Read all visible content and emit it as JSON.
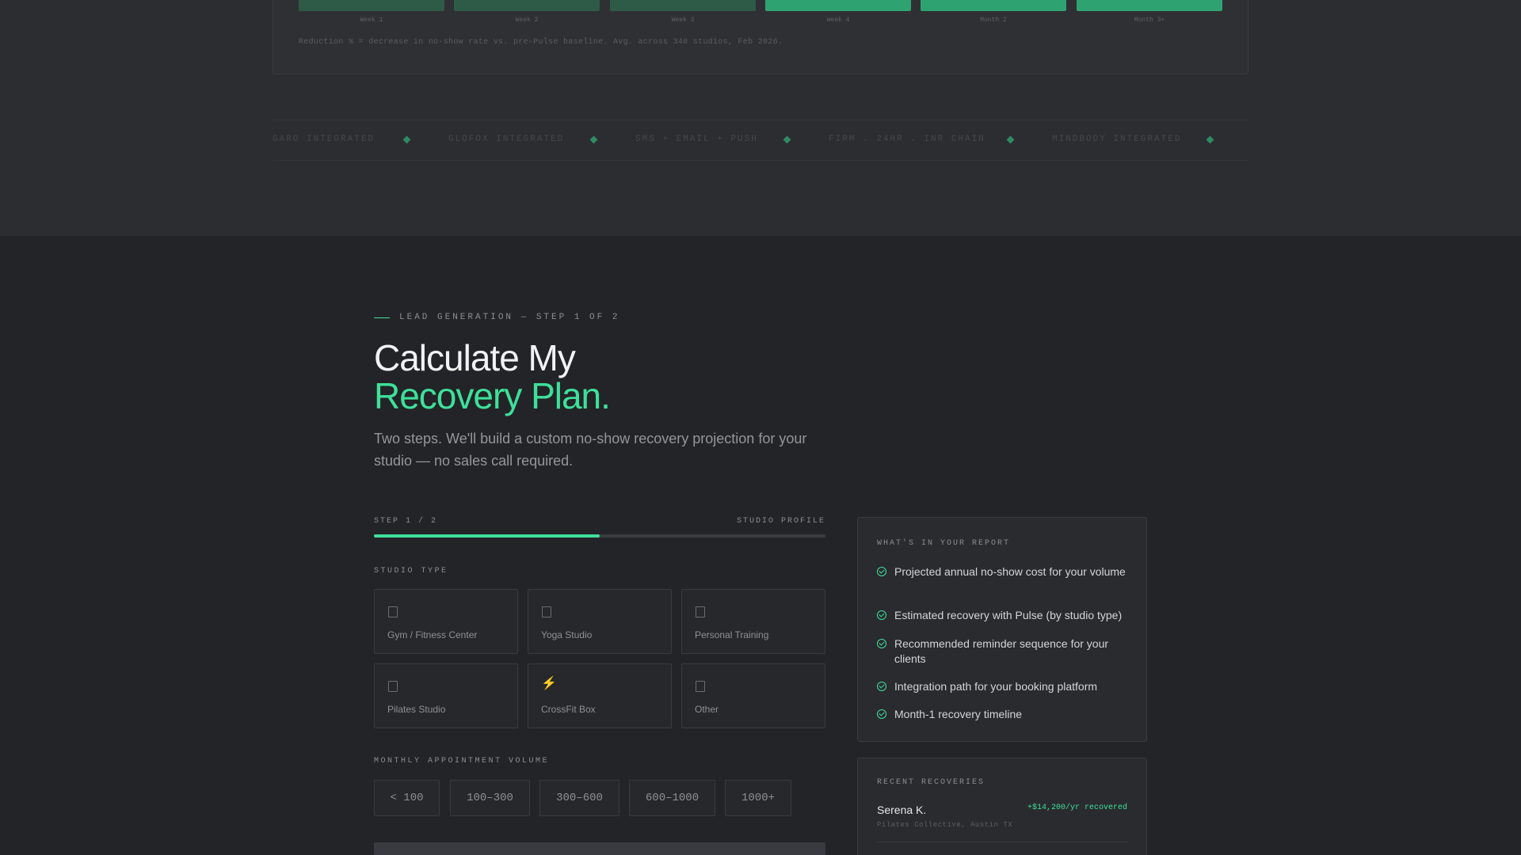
{
  "chart": {
    "bars": [
      {
        "label": "Week 1",
        "color": "#2e5a48"
      },
      {
        "label": "Week 2",
        "color": "#2e5a48"
      },
      {
        "label": "Week 3",
        "color": "#2e5a48"
      },
      {
        "label": "Week 4",
        "color": "#2fa271"
      },
      {
        "label": "Month 2",
        "color": "#2fa271"
      },
      {
        "label": "Month 3+",
        "color": "#2fa271"
      }
    ],
    "note": "Reduction % = decrease in no-show rate vs. pre-Pulse baseline. Avg. across 340 studios, Feb 2026."
  },
  "ticker": {
    "items": [
      "GARO INTEGRATED",
      "GLOFOX INTEGRATED",
      "SMS + EMAIL + PUSH",
      "FIRM . 24HR . INR CHAIN",
      "MINDBODY INTEGRATED"
    ]
  },
  "hero": {
    "eyebrow": "LEAD GENERATION — STEP 1 OF 2",
    "title_line1": "Calculate My",
    "title_line2": "Recovery Plan.",
    "subtitle": "Two steps. We'll build a custom no-show recovery projection for your studio — no sales call required."
  },
  "form": {
    "step_label": "STEP 1 / 2",
    "step_name": "STUDIO PROFILE",
    "progress": 0.5,
    "studio_type_label": "STUDIO TYPE",
    "studio_types": [
      {
        "label": "Gym / Fitness Center",
        "icon": "gym-icon"
      },
      {
        "label": "Yoga Studio",
        "icon": "yoga-icon"
      },
      {
        "label": "Personal Training",
        "icon": "training-icon"
      },
      {
        "label": "Pilates Studio",
        "icon": "pilates-icon"
      },
      {
        "label": "CrossFit Box",
        "icon": "lightning-icon"
      },
      {
        "label": "Other",
        "icon": "other-icon"
      }
    ],
    "volume_label": "MONTHLY APPOINTMENT VOLUME",
    "volumes": [
      "< 100",
      "100–300",
      "300–600",
      "600–1000",
      "1000+"
    ]
  },
  "report": {
    "title": "WHAT'S IN YOUR REPORT",
    "items": [
      "Projected annual no-show cost for your volume",
      "Estimated recovery with Pulse (by studio type)",
      "Recommended reminder sequence for your clients",
      "Integration path for your booking platform",
      "Month-1 recovery timeline"
    ]
  },
  "recoveries": {
    "title": "RECENT RECOVERIES",
    "entries": [
      {
        "name": "Serena K.",
        "amount": "+$14,200/yr recovered",
        "meta": "Pilates Collective, Austin TX"
      }
    ]
  },
  "colors": {
    "accent": "#3ee09a",
    "background": "#232427",
    "panel": "#2a2b2f"
  }
}
